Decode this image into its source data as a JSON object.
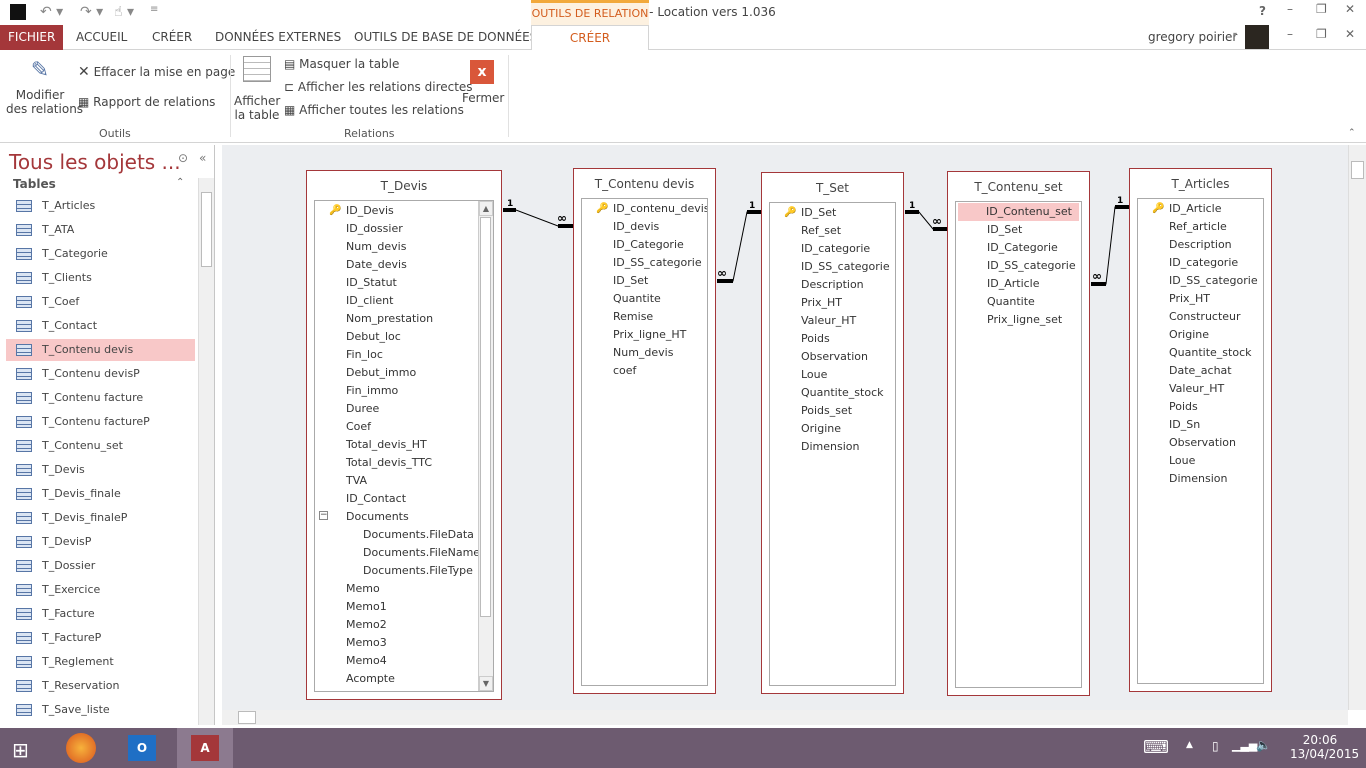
{
  "app": {
    "title": "Relations - Location vers 1.036",
    "context_tab": "OUTILS DE RELATION",
    "user": "gregory poirier",
    "help": "?"
  },
  "tabs": [
    "FICHIER",
    "ACCUEIL",
    "CRÉER",
    "DONNÉES EXTERNES",
    "OUTILS DE BASE DE DONNÉES",
    "CRÉER"
  ],
  "ribbon": {
    "modify": "Modifier",
    "modify2": "des relations",
    "clear": "Effacer la mise en page",
    "report": "Rapport de relations",
    "group1": "Outils",
    "show": "Afficher",
    "show2": "la table",
    "hide": "Masquer la table",
    "direct": "Afficher les relations directes",
    "all": "Afficher toutes les relations",
    "close": "Fermer",
    "group2": "Relations"
  },
  "nav": {
    "title": "Tous les objets ...",
    "section": "Tables",
    "selected": "T_Contenu devis",
    "items": [
      "T_Articles",
      "T_ATA",
      "T_Categorie",
      "T_Clients",
      "T_Coef",
      "T_Contact",
      "T_Contenu devis",
      "T_Contenu devisP",
      "T_Contenu facture",
      "T_Contenu factureP",
      "T_Contenu_set",
      "T_Devis",
      "T_Devis_finale",
      "T_Devis_finaleP",
      "T_DevisP",
      "T_Dossier",
      "T_Exercice",
      "T_Facture",
      "T_FactureP",
      "T_Reglement",
      "T_Reservation",
      "T_Save_liste"
    ]
  },
  "tables": [
    {
      "name": "T_Devis",
      "key": "ID_Devis",
      "fields": [
        "ID_Devis",
        "ID_dossier",
        "Num_devis",
        "Date_devis",
        "ID_Statut",
        "ID_client",
        "Nom_prestation",
        "Debut_loc",
        "Fin_loc",
        "Debut_immo",
        "Fin_immo",
        "Duree",
        "Coef",
        "Total_devis_HT",
        "Total_devis_TTC",
        "TVA",
        "ID_Contact",
        "Documents",
        "Documents.FileData",
        "Documents.FileName",
        "Documents.FileType",
        "Memo",
        "Memo1",
        "Memo2",
        "Memo3",
        "Memo4",
        "Acompte"
      ]
    },
    {
      "name": "T_Contenu devis",
      "key": "ID_contenu_devis",
      "fields": [
        "ID_contenu_devis",
        "ID_devis",
        "ID_Categorie",
        "ID_SS_categorie",
        "ID_Set",
        "Quantite",
        "Remise",
        "Prix_ligne_HT",
        "Num_devis",
        "coef"
      ]
    },
    {
      "name": "T_Set",
      "key": "ID_Set",
      "fields": [
        "ID_Set",
        "Ref_set",
        "ID_categorie",
        "ID_SS_categorie",
        "Description",
        "Prix_HT",
        "Valeur_HT",
        "Poids",
        "Observation",
        "Loue",
        "Quantite_stock",
        "Poids_set",
        "Origine",
        "Dimension"
      ]
    },
    {
      "name": "T_Contenu_set",
      "key": "ID_Contenu_set",
      "selected": "ID_Contenu_set",
      "fields": [
        "ID_Contenu_set",
        "ID_Set",
        "ID_Categorie",
        "ID_SS_categorie",
        "ID_Article",
        "Quantite",
        "Prix_ligne_set"
      ]
    },
    {
      "name": "T_Articles",
      "key": "ID_Article",
      "fields": [
        "ID_Article",
        "Ref_article",
        "Description",
        "ID_categorie",
        "ID_SS_categorie",
        "Prix_HT",
        "Constructeur",
        "Origine",
        "Quantite_stock",
        "Date_achat",
        "Valeur_HT",
        "Poids",
        "ID_Sn",
        "Observation",
        "Loue",
        "Dimension"
      ]
    }
  ],
  "relations": [
    {
      "one": "1",
      "many": "∞"
    },
    {
      "one": "1",
      "many": "∞"
    },
    {
      "one": "1",
      "many": "∞"
    },
    {
      "one": "1",
      "many": "∞"
    }
  ],
  "taskbar": {
    "time": "20:06",
    "date": "13/04/2015"
  },
  "colors": {
    "accent": "#a4373a",
    "context": "#d35d1e",
    "taskbar": "#6d5b70"
  }
}
